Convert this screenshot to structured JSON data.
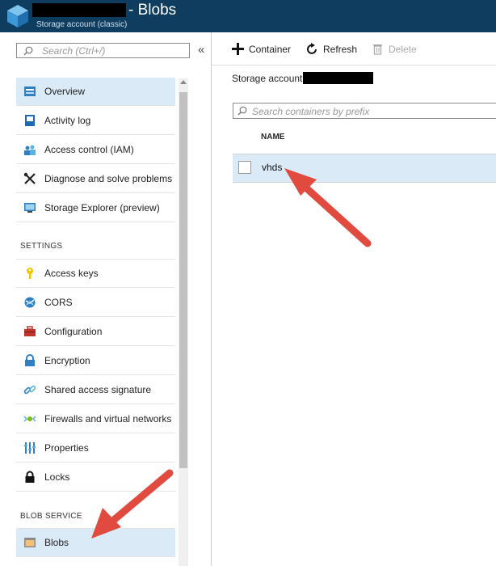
{
  "header": {
    "title": "- Blobs",
    "subtitle": "Storage account (classic)"
  },
  "sidebar": {
    "search_placeholder": "Search (Ctrl+/)",
    "collapse_glyph": "«",
    "items_top": [
      {
        "label": "Overview",
        "icon": "overview-icon"
      },
      {
        "label": "Activity log",
        "icon": "activity-log-icon"
      },
      {
        "label": "Access control (IAM)",
        "icon": "access-control-icon"
      },
      {
        "label": "Diagnose and solve problems",
        "icon": "wrench-icon"
      },
      {
        "label": "Storage Explorer (preview)",
        "icon": "storage-explorer-icon"
      }
    ],
    "settings_header": "SETTINGS",
    "settings_items": [
      {
        "label": "Access keys",
        "icon": "key-icon"
      },
      {
        "label": "CORS",
        "icon": "cors-icon"
      },
      {
        "label": "Configuration",
        "icon": "configuration-icon"
      },
      {
        "label": "Encryption",
        "icon": "lock-icon"
      },
      {
        "label": "Shared access signature",
        "icon": "link-icon"
      },
      {
        "label": "Firewalls and virtual networks",
        "icon": "firewall-icon"
      },
      {
        "label": "Properties",
        "icon": "properties-icon"
      },
      {
        "label": "Locks",
        "icon": "padlock-icon"
      }
    ],
    "blob_header": "BLOB SERVICE",
    "blob_items": [
      {
        "label": "Blobs",
        "icon": "blobs-icon"
      }
    ]
  },
  "toolbar": {
    "container_label": "Container",
    "refresh_label": "Refresh",
    "delete_label": "Delete"
  },
  "main": {
    "storage_account_label": "Storage account:",
    "search_placeholder": "Search containers by prefix",
    "column_name": "NAME",
    "rows": [
      {
        "name": "vhds"
      }
    ]
  },
  "colors": {
    "header_bg": "#0e3d5f",
    "selected_bg": "#dbeaf7",
    "annotation_arrow": "#e04a3f"
  }
}
